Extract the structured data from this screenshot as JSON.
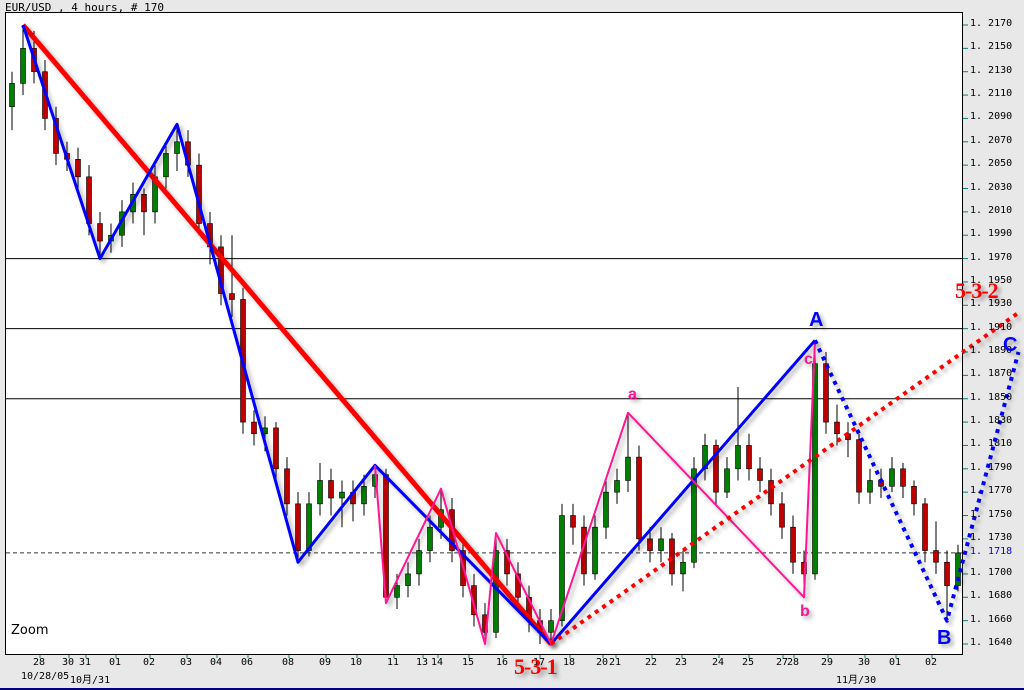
{
  "header": {
    "title": "EUR/USD , 4 hours, # 170"
  },
  "zoom_label": "Zoom",
  "colors": {
    "bull": "#008000",
    "bear": "#c00000",
    "wave_red": "#ff0000",
    "wave_blue": "#0000ff",
    "wave_pink": "#ff1493",
    "current_price": "#0000ff"
  },
  "chart_data": {
    "type": "candlestick",
    "symbol": "EUR/USD",
    "timeframe": "4 hours",
    "ylim": [
      1.163,
      1.218
    ],
    "ytick_step": 0.002,
    "ytick_labels": [
      "1.2170",
      "1.2150",
      "1.2130",
      "1.2110",
      "1.2090",
      "1.2070",
      "1.2050",
      "1.2030",
      "1.2010",
      "1.1990",
      "1.1970",
      "1.1950",
      "1.1930",
      "1.1910",
      "1.1890",
      "1.1870",
      "1.1850",
      "1.1830",
      "1.1810",
      "1.1790",
      "1.1770",
      "1.1750",
      "1.1730",
      "1.1700",
      "1.1680",
      "1.1660",
      "1.1640"
    ],
    "current_price": "1.1718",
    "horizontal_lines": [
      1.197,
      1.191,
      1.185
    ],
    "xtick_labels": [
      "28",
      "30",
      "31",
      "01",
      "02",
      "03",
      "04",
      "06",
      "08",
      "09",
      "10",
      "11",
      "13",
      "14",
      "15",
      "16",
      "17",
      "18",
      "20",
      "21",
      "22",
      "23",
      "24",
      "25",
      "27",
      "28",
      "29",
      "30",
      "01",
      "02"
    ],
    "xdate_labels": [
      "10/28/05",
      "10月/31",
      "11月/30"
    ],
    "ohlc": [
      [
        1.21,
        1.213,
        1.208,
        1.212
      ],
      [
        1.212,
        1.217,
        1.211,
        1.215
      ],
      [
        1.215,
        1.2165,
        1.212,
        1.213
      ],
      [
        1.213,
        1.214,
        1.208,
        1.209
      ],
      [
        1.209,
        1.21,
        1.205,
        1.206
      ],
      [
        1.206,
        1.207,
        1.2045,
        1.2055
      ],
      [
        1.2055,
        1.2065,
        1.203,
        1.204
      ],
      [
        1.204,
        1.205,
        1.199,
        1.2
      ],
      [
        1.2,
        1.201,
        1.197,
        1.1985
      ],
      [
        1.1985,
        1.2,
        1.1975,
        1.199
      ],
      [
        1.199,
        1.202,
        1.198,
        1.201
      ],
      [
        1.201,
        1.2035,
        1.2,
        1.2025
      ],
      [
        1.2025,
        1.203,
        1.199,
        1.201
      ],
      [
        1.201,
        1.205,
        1.2,
        1.204
      ],
      [
        1.204,
        1.207,
        1.203,
        1.206
      ],
      [
        1.206,
        1.2085,
        1.2045,
        1.207
      ],
      [
        1.207,
        1.208,
        1.204,
        1.205
      ],
      [
        1.205,
        1.206,
        1.199,
        1.2
      ],
      [
        1.2,
        1.201,
        1.1965,
        1.198
      ],
      [
        1.198,
        1.199,
        1.193,
        1.194
      ],
      [
        1.194,
        1.199,
        1.192,
        1.1935
      ],
      [
        1.1935,
        1.1945,
        1.182,
        1.183
      ],
      [
        1.183,
        1.184,
        1.181,
        1.182
      ],
      [
        1.182,
        1.1835,
        1.1805,
        1.1825
      ],
      [
        1.1825,
        1.183,
        1.178,
        1.179
      ],
      [
        1.179,
        1.18,
        1.175,
        1.176
      ],
      [
        1.176,
        1.177,
        1.171,
        1.172
      ],
      [
        1.172,
        1.177,
        1.1715,
        1.176
      ],
      [
        1.176,
        1.1795,
        1.175,
        1.178
      ],
      [
        1.178,
        1.179,
        1.175,
        1.1765
      ],
      [
        1.1765,
        1.178,
        1.174,
        1.177
      ],
      [
        1.177,
        1.178,
        1.1745,
        1.176
      ],
      [
        1.176,
        1.1785,
        1.175,
        1.1775
      ],
      [
        1.1775,
        1.1793,
        1.1765,
        1.1785
      ],
      [
        1.1785,
        1.179,
        1.1675,
        1.168
      ],
      [
        1.168,
        1.17,
        1.167,
        1.169
      ],
      [
        1.169,
        1.171,
        1.168,
        1.17
      ],
      [
        1.17,
        1.173,
        1.169,
        1.172
      ],
      [
        1.172,
        1.175,
        1.171,
        1.174
      ],
      [
        1.174,
        1.1773,
        1.173,
        1.1755
      ],
      [
        1.1755,
        1.1765,
        1.171,
        1.172
      ],
      [
        1.172,
        1.173,
        1.168,
        1.169
      ],
      [
        1.169,
        1.17,
        1.1655,
        1.1665
      ],
      [
        1.1665,
        1.1675,
        1.164,
        1.165
      ],
      [
        1.165,
        1.1735,
        1.1645,
        1.172
      ],
      [
        1.172,
        1.173,
        1.169,
        1.17
      ],
      [
        1.17,
        1.171,
        1.167,
        1.168
      ],
      [
        1.168,
        1.169,
        1.165,
        1.166
      ],
      [
        1.166,
        1.167,
        1.164,
        1.165
      ],
      [
        1.165,
        1.167,
        1.164,
        1.166
      ],
      [
        1.166,
        1.176,
        1.1655,
        1.175
      ],
      [
        1.175,
        1.176,
        1.1725,
        1.174
      ],
      [
        1.174,
        1.175,
        1.169,
        1.17
      ],
      [
        1.17,
        1.175,
        1.1695,
        1.174
      ],
      [
        1.174,
        1.178,
        1.173,
        1.177
      ],
      [
        1.177,
        1.179,
        1.176,
        1.178
      ],
      [
        1.178,
        1.1838,
        1.177,
        1.18
      ],
      [
        1.18,
        1.181,
        1.172,
        1.173
      ],
      [
        1.173,
        1.174,
        1.171,
        1.172
      ],
      [
        1.172,
        1.174,
        1.171,
        1.173
      ],
      [
        1.173,
        1.1735,
        1.169,
        1.17
      ],
      [
        1.17,
        1.172,
        1.1685,
        1.171
      ],
      [
        1.171,
        1.18,
        1.1705,
        1.179
      ],
      [
        1.179,
        1.182,
        1.178,
        1.181
      ],
      [
        1.181,
        1.1815,
        1.176,
        1.177
      ],
      [
        1.177,
        1.18,
        1.1765,
        1.179
      ],
      [
        1.179,
        1.186,
        1.178,
        1.181
      ],
      [
        1.181,
        1.182,
        1.178,
        1.179
      ],
      [
        1.179,
        1.18,
        1.177,
        1.178
      ],
      [
        1.178,
        1.179,
        1.175,
        1.176
      ],
      [
        1.176,
        1.177,
        1.173,
        1.174
      ],
      [
        1.174,
        1.175,
        1.17,
        1.171
      ],
      [
        1.171,
        1.172,
        1.168,
        1.17
      ],
      [
        1.17,
        1.19,
        1.1695,
        1.188
      ],
      [
        1.188,
        1.189,
        1.182,
        1.183
      ],
      [
        1.183,
        1.1845,
        1.181,
        1.182
      ],
      [
        1.182,
        1.183,
        1.18,
        1.1815
      ],
      [
        1.1815,
        1.182,
        1.176,
        1.177
      ],
      [
        1.177,
        1.179,
        1.176,
        1.178
      ],
      [
        1.178,
        1.179,
        1.1765,
        1.1775
      ],
      [
        1.1775,
        1.18,
        1.177,
        1.179
      ],
      [
        1.179,
        1.1795,
        1.1765,
        1.1775
      ],
      [
        1.1775,
        1.178,
        1.175,
        1.176
      ],
      [
        1.176,
        1.1765,
        1.171,
        1.172
      ],
      [
        1.172,
        1.1745,
        1.17,
        1.171
      ],
      [
        1.171,
        1.172,
        1.166,
        1.169
      ],
      [
        1.169,
        1.1725,
        1.1685,
        1.1718
      ]
    ],
    "wave_lines": [
      {
        "style": "solid-thick",
        "color": "#ff0000",
        "points": [
          [
            1,
            1.217
          ],
          [
            49,
            1.164
          ]
        ]
      },
      {
        "style": "solid",
        "color": "#0000ff",
        "points": [
          [
            1,
            1.217
          ],
          [
            8,
            1.197
          ],
          [
            15,
            1.2085
          ],
          [
            26,
            1.171
          ],
          [
            33,
            1.1793
          ],
          [
            49,
            1.164
          ],
          [
            73,
            1.19
          ]
        ]
      },
      {
        "style": "solid-thin",
        "color": "#ff1493",
        "points": [
          [
            33,
            1.1793
          ],
          [
            34,
            1.1675
          ],
          [
            39,
            1.1773
          ],
          [
            43,
            1.164
          ],
          [
            44,
            1.1735
          ],
          [
            49,
            1.164
          ],
          [
            56,
            1.1838
          ],
          [
            72,
            1.168
          ],
          [
            73,
            1.19
          ]
        ]
      },
      {
        "style": "dotted",
        "color": "#0000ff",
        "points": [
          [
            73,
            1.19
          ],
          [
            85,
            1.166
          ],
          [
            91.5,
            1.189
          ]
        ]
      },
      {
        "style": "dotted",
        "color": "#ff0000",
        "points": [
          [
            49,
            1.164
          ],
          [
            91.7,
            1.1925
          ]
        ]
      }
    ],
    "annotations": {
      "w531": "5-3-1",
      "w532": "5-3-2",
      "A": "A",
      "B": "B",
      "C": "C",
      "a": "a",
      "b": "b",
      "c": "c"
    }
  }
}
